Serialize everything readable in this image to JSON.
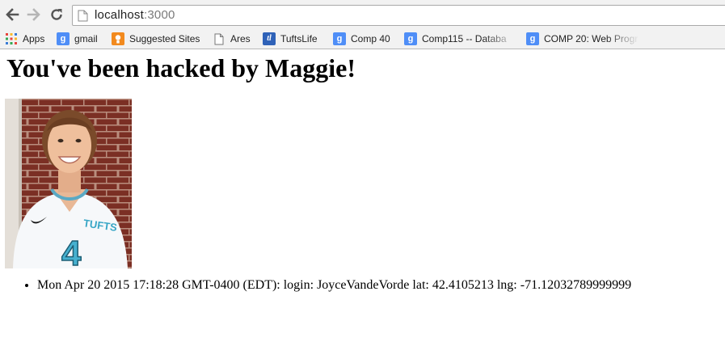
{
  "browser": {
    "url_host": "localhost",
    "url_port": ":3000",
    "bookmarks": [
      {
        "label": "Apps",
        "icon": "apps-grid-icon"
      },
      {
        "label": "gmail",
        "icon": "google-icon"
      },
      {
        "label": "Suggested Sites",
        "icon": "suggested-sites-icon"
      },
      {
        "label": "Ares",
        "icon": "page-icon"
      },
      {
        "label": "TuftsLife",
        "icon": "tuftslife-icon"
      },
      {
        "label": "Comp 40",
        "icon": "google-icon"
      },
      {
        "label": "Comp115 -- Databa",
        "icon": "google-icon"
      },
      {
        "label": "COMP 20: Web Progr",
        "icon": "google-icon"
      }
    ]
  },
  "page": {
    "headline": "You've been hacked by Maggie!",
    "photo_alt": "Photo of a smiling player in a Tufts #4 jersey",
    "jersey_text": "TUFTS",
    "jersey_number": "4",
    "log": [
      "Mon Apr 20 2015 17:18:28 GMT-0400 (EDT): login: JoyceVandeVorde lat: 42.4105213 lng: -71.12032789999999"
    ]
  }
}
